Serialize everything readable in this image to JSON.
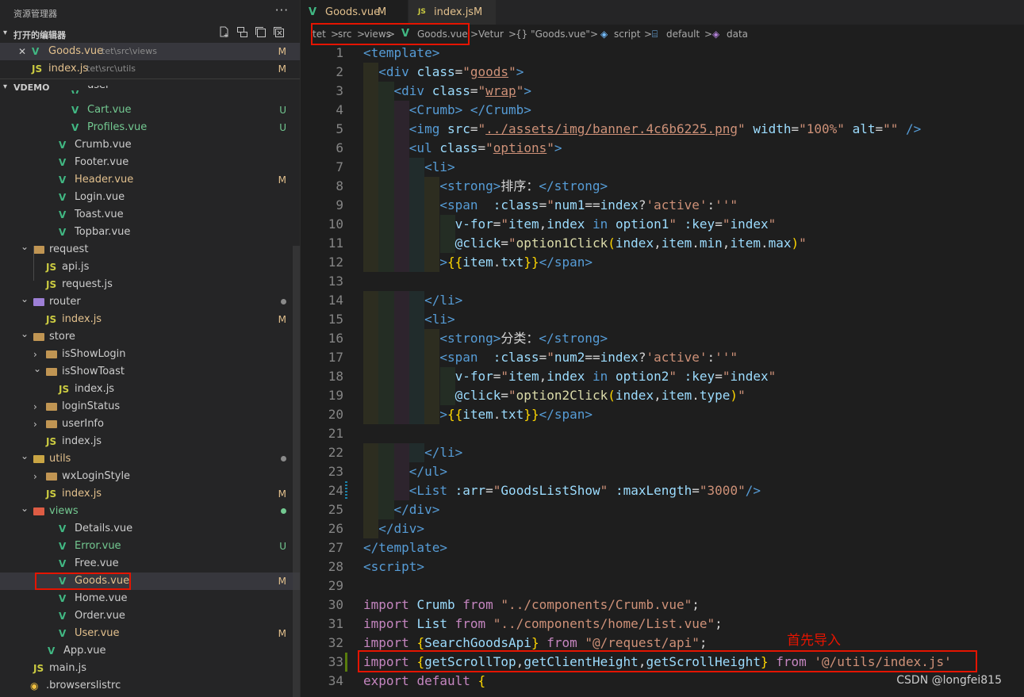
{
  "explorer": {
    "title": "资源管理器",
    "more": "···",
    "open_editors_label": "打开的编辑器",
    "project_label": "VDEMO",
    "open_editors": [
      {
        "name": "Goods.vue",
        "path": "tet\\src\\views",
        "badge": "M",
        "close": "✕",
        "icon": "vue"
      },
      {
        "name": "index.js",
        "path": "tet\\src\\utils",
        "badge": "M",
        "icon": "js"
      }
    ],
    "tree": [
      {
        "name": "user",
        "indent": 3,
        "icon": "vue",
        "partial": true
      },
      {
        "name": "Cart.vue",
        "indent": 3,
        "icon": "vue",
        "badge": "U",
        "color": "untracked"
      },
      {
        "name": "Profiles.vue",
        "indent": 3,
        "icon": "vue",
        "badge": "U",
        "color": "untracked"
      },
      {
        "name": "Crumb.vue",
        "indent": 2,
        "icon": "vue"
      },
      {
        "name": "Footer.vue",
        "indent": 2,
        "icon": "vue"
      },
      {
        "name": "Header.vue",
        "indent": 2,
        "icon": "vue",
        "badge": "M",
        "color": "modified"
      },
      {
        "name": "Login.vue",
        "indent": 2,
        "icon": "vue"
      },
      {
        "name": "Toast.vue",
        "indent": 2,
        "icon": "vue"
      },
      {
        "name": "Topbar.vue",
        "indent": 2,
        "icon": "vue"
      },
      {
        "name": "request",
        "indent": 1,
        "icon": "folder",
        "chevron": "down"
      },
      {
        "name": "api.js",
        "indent": 2,
        "icon": "js"
      },
      {
        "name": "request.js",
        "indent": 2,
        "icon": "js"
      },
      {
        "name": "router",
        "indent": 1,
        "icon": "folder-purple",
        "chevron": "down",
        "dot": "grey"
      },
      {
        "name": "index.js",
        "indent": 2,
        "icon": "js",
        "badge": "M",
        "color": "modified"
      },
      {
        "name": "store",
        "indent": 1,
        "icon": "folder",
        "chevron": "down"
      },
      {
        "name": "isShowLogin",
        "indent": 2,
        "icon": "folder",
        "chevron": "right"
      },
      {
        "name": "isShowToast",
        "indent": 2,
        "icon": "folder",
        "chevron": "down"
      },
      {
        "name": "index.js",
        "indent": 3,
        "icon": "js"
      },
      {
        "name": "loginStatus",
        "indent": 2,
        "icon": "folder",
        "chevron": "right"
      },
      {
        "name": "userInfo",
        "indent": 2,
        "icon": "folder",
        "chevron": "right"
      },
      {
        "name": "index.js",
        "indent": 2,
        "icon": "js"
      },
      {
        "name": "utils",
        "indent": 1,
        "icon": "folder-yellow",
        "chevron": "down",
        "dot": "grey",
        "color": "modified"
      },
      {
        "name": "wxLoginStyle",
        "indent": 2,
        "icon": "folder",
        "chevron": "right"
      },
      {
        "name": "index.js",
        "indent": 2,
        "icon": "js",
        "badge": "M",
        "color": "modified"
      },
      {
        "name": "views",
        "indent": 1,
        "icon": "folder-red",
        "chevron": "down",
        "dot": "green",
        "color": "untracked"
      },
      {
        "name": "Details.vue",
        "indent": 2,
        "icon": "vue"
      },
      {
        "name": "Error.vue",
        "indent": 2,
        "icon": "vue",
        "badge": "U",
        "color": "untracked"
      },
      {
        "name": "Free.vue",
        "indent": 2,
        "icon": "vue"
      },
      {
        "name": "Goods.vue",
        "indent": 2,
        "icon": "vue",
        "badge": "M",
        "color": "modified",
        "selected": true
      },
      {
        "name": "Home.vue",
        "indent": 2,
        "icon": "vue"
      },
      {
        "name": "Order.vue",
        "indent": 2,
        "icon": "vue"
      },
      {
        "name": "User.vue",
        "indent": 2,
        "icon": "vue",
        "badge": "M",
        "color": "modified"
      },
      {
        "name": "App.vue",
        "indent": 1,
        "icon": "vue"
      },
      {
        "name": "main.js",
        "indent": 1,
        "icon": "js"
      },
      {
        "name": ".browserslistrc",
        "indent": 1,
        "icon": "dot-file"
      }
    ]
  },
  "tabs": [
    {
      "name": "Goods.vue",
      "badge": "M",
      "icon": "vue",
      "active": true
    },
    {
      "name": "index.js",
      "badge": "M",
      "icon": "js",
      "active": false
    }
  ],
  "breadcrumb": [
    "tet",
    ">",
    "src",
    ">",
    "views",
    ">",
    "Goods.vue",
    ">",
    "Vetur",
    ">",
    "{} \"Goods.vue\"",
    ">",
    "script",
    ">",
    "default",
    ">",
    "data"
  ],
  "code_lines": [
    {
      "n": "1",
      "html": "<span class='t'>&lt;template&gt;</span>"
    },
    {
      "n": "2",
      "html": "  <span class='t'>&lt;div</span> <span class='a'>class</span>=<span class='s'>\"<span class='ul'>goods</span>\"</span><span class='t'>&gt;</span>"
    },
    {
      "n": "3",
      "html": "    <span class='t'>&lt;div</span> <span class='a'>class</span>=<span class='s'>\"<span class='ul'>wrap</span>\"</span><span class='t'>&gt;</span>"
    },
    {
      "n": "4",
      "html": "      <span class='t'>&lt;Crumb&gt;</span> <span class='t'>&lt;/Crumb&gt;</span>"
    },
    {
      "n": "5",
      "html": "      <span class='t'>&lt;img</span> <span class='a'>src</span>=<span class='s'>\"<span class='ul'>../assets/img/banner.4c6b6225.png</span>\"</span> <span class='a'>width</span>=<span class='s'>\"100%\"</span> <span class='a'>alt</span>=<span class='s'>\"\"</span> <span class='t'>/&gt;</span>"
    },
    {
      "n": "6",
      "html": "      <span class='t'>&lt;ul</span> <span class='a'>class</span>=<span class='s'>\"<span class='ul'>options</span>\"</span><span class='t'>&gt;</span>"
    },
    {
      "n": "7",
      "html": "        <span class='t'>&lt;li&gt;</span>"
    },
    {
      "n": "8",
      "html": "          <span class='t'>&lt;strong&gt;</span><span class='tx'>排序：</span><span class='t'>&lt;/strong&gt;</span>"
    },
    {
      "n": "9",
      "html": "          <span class='t'>&lt;span</span>  <span class='a'>:class</span>=<span class='s'>\"</span><span class='a'>num1</span>==<span class='a'>index</span>?<span class='s'>'active'</span>:<span class='s'>''</span><span class='s'>\"</span>"
    },
    {
      "n": "10",
      "html": "            <span class='a'>v-for</span>=<span class='s'>\"</span><span class='a'>item</span>,<span class='a'>index</span> <span class='t'>in</span> <span class='a'>option1</span><span class='s'>\"</span> <span class='a'>:key</span>=<span class='s'>\"</span><span class='a'>index</span><span class='s'>\"</span>"
    },
    {
      "n": "11",
      "html": "            <span class='a'>@click</span>=<span class='s'>\"</span><span class='f'>option1Click</span><span class='y'>(</span><span class='a'>index</span>,<span class='a'>item</span>.<span class='a'>min</span>,<span class='a'>item</span>.<span class='a'>max</span><span class='y'>)</span><span class='s'>\"</span>"
    },
    {
      "n": "12",
      "html": "          <span class='t'>&gt;</span><span class='y'>{{</span><span class='a'>item</span>.<span class='a'>txt</span><span class='y'>}}</span><span class='t'>&lt;/span&gt;</span>"
    },
    {
      "n": "13",
      "html": ""
    },
    {
      "n": "14",
      "html": "        <span class='t'>&lt;/li&gt;</span>"
    },
    {
      "n": "15",
      "html": "        <span class='t'>&lt;li&gt;</span>"
    },
    {
      "n": "16",
      "html": "          <span class='t'>&lt;strong&gt;</span><span class='tx'>分类：</span><span class='t'>&lt;/strong&gt;</span>"
    },
    {
      "n": "17",
      "html": "          <span class='t'>&lt;span</span>  <span class='a'>:class</span>=<span class='s'>\"</span><span class='a'>num2</span>==<span class='a'>index</span>?<span class='s'>'active'</span>:<span class='s'>''</span><span class='s'>\"</span>"
    },
    {
      "n": "18",
      "html": "            <span class='a'>v-for</span>=<span class='s'>\"</span><span class='a'>item</span>,<span class='a'>index</span> <span class='t'>in</span> <span class='a'>option2</span><span class='s'>\"</span> <span class='a'>:key</span>=<span class='s'>\"</span><span class='a'>index</span><span class='s'>\"</span>"
    },
    {
      "n": "19",
      "html": "            <span class='a'>@click</span>=<span class='s'>\"</span><span class='f'>option2Click</span><span class='y'>(</span><span class='a'>index</span>,<span class='a'>item</span>.<span class='a'>type</span><span class='y'>)</span><span class='s'>\"</span>"
    },
    {
      "n": "20",
      "html": "          <span class='t'>&gt;</span><span class='y'>{{</span><span class='a'>item</span>.<span class='a'>txt</span><span class='y'>}}</span><span class='t'>&lt;/span&gt;</span>"
    },
    {
      "n": "21",
      "html": ""
    },
    {
      "n": "22",
      "html": "        <span class='t'>&lt;/li&gt;</span>"
    },
    {
      "n": "23",
      "html": "      <span class='t'>&lt;/ul&gt;</span>"
    },
    {
      "n": "24",
      "html": "      <span class='t'>&lt;List</span> <span class='a'>:arr</span>=<span class='s'>\"</span><span class='a'>GoodsListShow</span><span class='s'>\"</span> <span class='a'>:maxLength</span>=<span class='s'>\"3000\"</span><span class='t'>/&gt;</span>"
    },
    {
      "n": "25",
      "html": "    <span class='t'>&lt;/div&gt;</span>"
    },
    {
      "n": "26",
      "html": "  <span class='t'>&lt;/div&gt;</span>"
    },
    {
      "n": "27",
      "html": "<span class='t'>&lt;/template&gt;</span>"
    },
    {
      "n": "28",
      "html": "<span class='t'>&lt;script&gt;</span>"
    },
    {
      "n": "29",
      "html": ""
    },
    {
      "n": "30",
      "html": "<span class='k'>import</span> <span class='a'>Crumb</span> <span class='k'>from</span> <span class='s'>\"../components/Crumb.vue\"</span>;"
    },
    {
      "n": "31",
      "html": "<span class='k'>import</span> <span class='a'>List</span> <span class='k'>from</span> <span class='s'>\"../components/home/List.vue\"</span>;"
    },
    {
      "n": "32",
      "html": "<span class='k'>import</span> <span class='y'>{</span><span class='a'>SearchGoodsApi</span><span class='y'>}</span> <span class='k'>from</span> <span class='s'>\"@/request/api\"</span>;"
    },
    {
      "n": "33",
      "html": "<span class='k'>import</span> <span class='y'>{</span><span class='a'>getScrollTop</span>,<span class='a'>getClientHeight</span>,<span class='a'>getScrollHeight</span><span class='y'>}</span> <span class='k'>from</span> <span class='s'>'@/utils/index.js'</span>"
    },
    {
      "n": "34",
      "html": "<span class='k'>export</span> <span class='k'>default</span> <span class='y'>{</span>"
    }
  ],
  "annotation": "首先导入",
  "watermark": "CSDN @longfei815"
}
